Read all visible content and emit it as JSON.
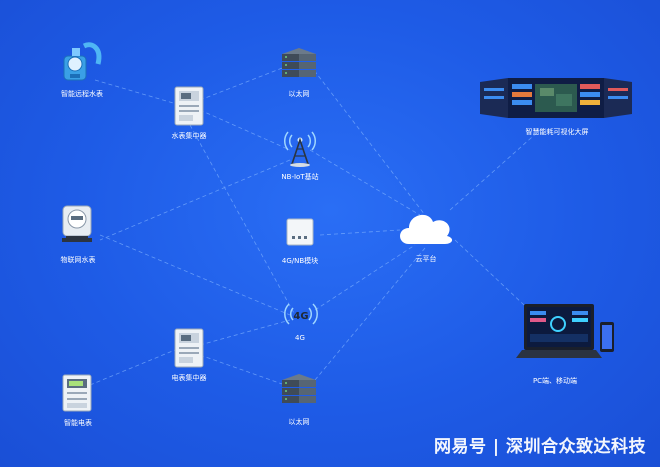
{
  "colors": {
    "background": "#1f5fe8",
    "link": "#7fb2ff",
    "label": "#ffffff"
  },
  "nodes": {
    "water_meter_remote": {
      "label": "智能远程水表",
      "icon": "water-meter-icon"
    },
    "water_concentrator": {
      "label": "水表集中器",
      "icon": "concentrator-icon"
    },
    "ethernet_top": {
      "label": "以太网",
      "icon": "server-stack-icon"
    },
    "nbiot_station": {
      "label": "NB-IoT基站",
      "icon": "antenna-tower-icon"
    },
    "dashboard_screen": {
      "label": "智慧能耗可视化大屏",
      "icon": "dashboard-screen-icon"
    },
    "iot_water_meter": {
      "label": "物联网水表",
      "icon": "iot-water-meter-icon"
    },
    "module_4g_nb": {
      "label": "4G/NB模块",
      "icon": "module-box-icon"
    },
    "cloud_platform": {
      "label": "云平台",
      "icon": "cloud-icon"
    },
    "network_4g": {
      "label": "4G",
      "icon": "4g-signal-icon"
    },
    "electric_concentrator": {
      "label": "电表集中器",
      "icon": "concentrator-icon"
    },
    "pc_mobile": {
      "label": "PC端、移动端",
      "icon": "laptop-phone-icon"
    },
    "smart_meter": {
      "label": "智能电表",
      "icon": "electric-meter-icon"
    },
    "ethernet_bottom": {
      "label": "以太网",
      "icon": "server-stack-icon"
    }
  },
  "watermark": "网易号 | 深圳合众致达科技"
}
